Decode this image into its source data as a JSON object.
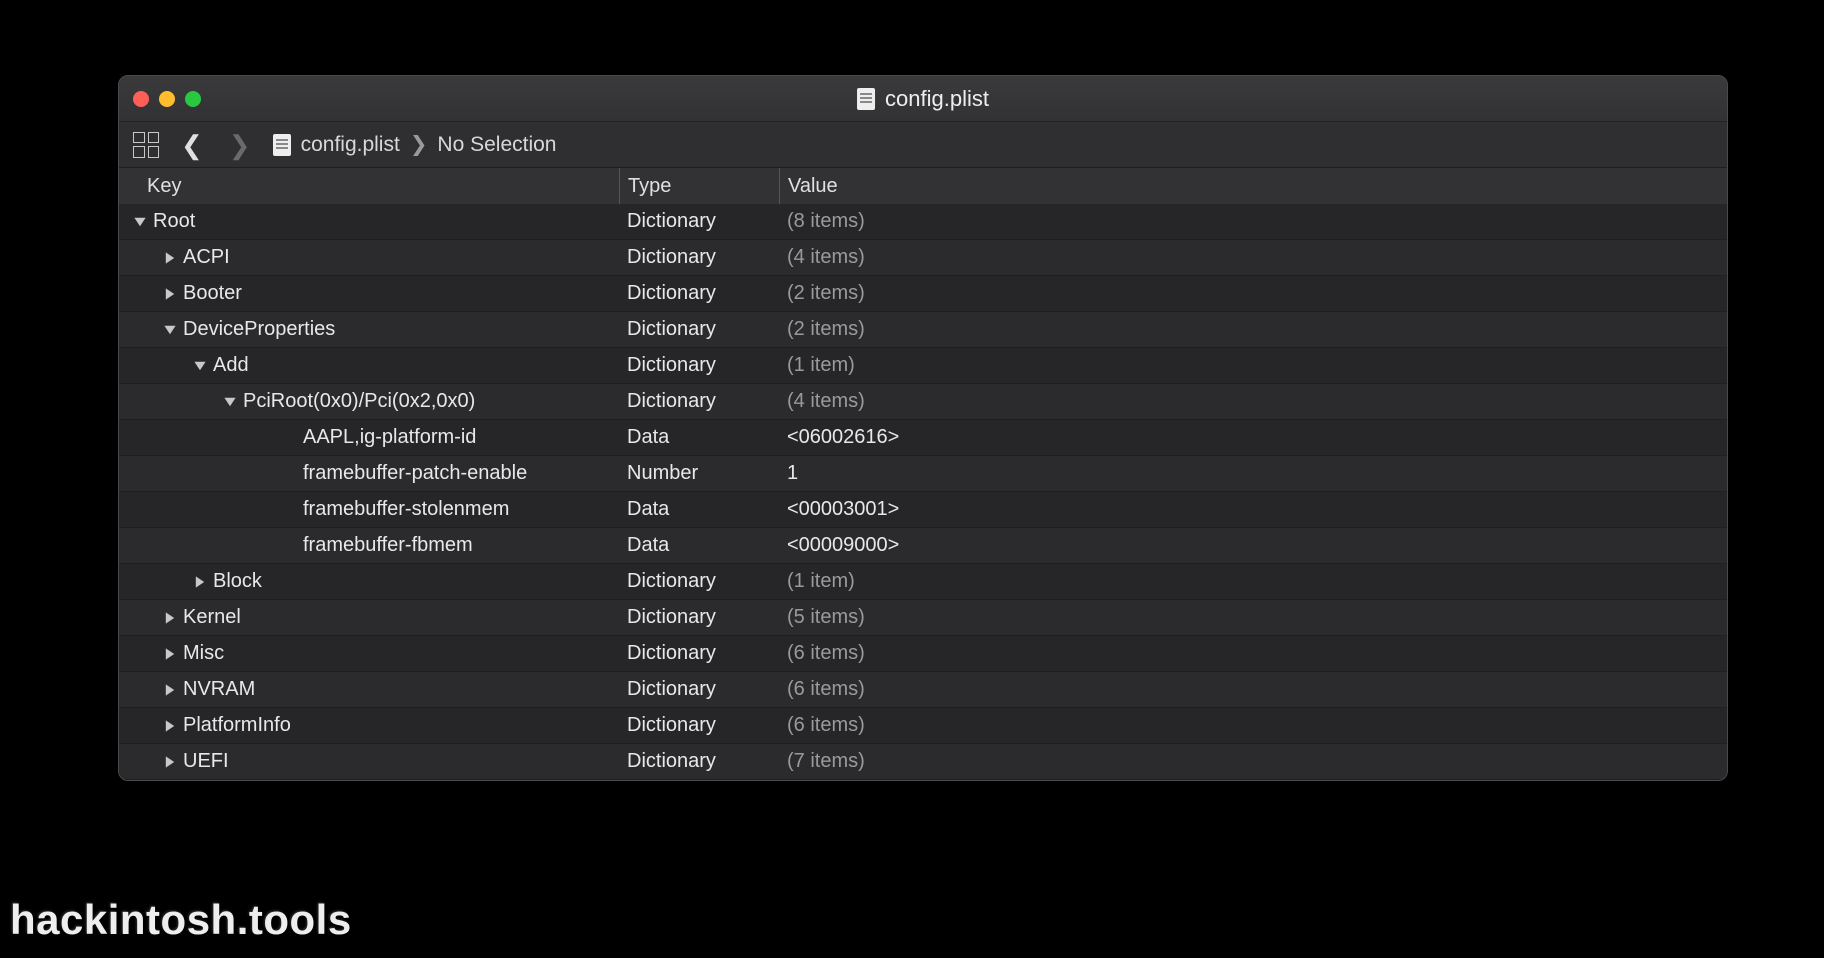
{
  "window": {
    "title": "config.plist"
  },
  "toolbar": {
    "breadcrumb_file": "config.plist",
    "breadcrumb_selection": "No Selection"
  },
  "headers": {
    "key": "Key",
    "type": "Type",
    "value": "Value"
  },
  "rows": [
    {
      "indent": 0,
      "disclosure": "down",
      "key": "Root",
      "type": "Dictionary",
      "value": "(8 items)",
      "dim": true
    },
    {
      "indent": 1,
      "disclosure": "right",
      "key": "ACPI",
      "type": "Dictionary",
      "value": "(4 items)",
      "dim": true
    },
    {
      "indent": 1,
      "disclosure": "right",
      "key": "Booter",
      "type": "Dictionary",
      "value": "(2 items)",
      "dim": true
    },
    {
      "indent": 1,
      "disclosure": "down",
      "key": "DeviceProperties",
      "type": "Dictionary",
      "value": "(2 items)",
      "dim": true
    },
    {
      "indent": 2,
      "disclosure": "down",
      "key": "Add",
      "type": "Dictionary",
      "value": "(1 item)",
      "dim": true
    },
    {
      "indent": 3,
      "disclosure": "down",
      "key": "PciRoot(0x0)/Pci(0x2,0x0)",
      "type": "Dictionary",
      "value": "(4 items)",
      "dim": true
    },
    {
      "indent": 4,
      "disclosure": "none",
      "key": "AAPL,ig-platform-id",
      "type": "Data",
      "value": "<06002616>",
      "dim": false
    },
    {
      "indent": 4,
      "disclosure": "none",
      "key": "framebuffer-patch-enable",
      "type": "Number",
      "value": "1",
      "dim": false
    },
    {
      "indent": 4,
      "disclosure": "none",
      "key": "framebuffer-stolenmem",
      "type": "Data",
      "value": "<00003001>",
      "dim": false
    },
    {
      "indent": 4,
      "disclosure": "none",
      "key": "framebuffer-fbmem",
      "type": "Data",
      "value": "<00009000>",
      "dim": false
    },
    {
      "indent": 2,
      "disclosure": "right",
      "key": "Block",
      "type": "Dictionary",
      "value": "(1 item)",
      "dim": true
    },
    {
      "indent": 1,
      "disclosure": "right",
      "key": "Kernel",
      "type": "Dictionary",
      "value": "(5 items)",
      "dim": true
    },
    {
      "indent": 1,
      "disclosure": "right",
      "key": "Misc",
      "type": "Dictionary",
      "value": "(6 items)",
      "dim": true
    },
    {
      "indent": 1,
      "disclosure": "right",
      "key": "NVRAM",
      "type": "Dictionary",
      "value": "(6 items)",
      "dim": true
    },
    {
      "indent": 1,
      "disclosure": "right",
      "key": "PlatformInfo",
      "type": "Dictionary",
      "value": "(6 items)",
      "dim": true
    },
    {
      "indent": 1,
      "disclosure": "right",
      "key": "UEFI",
      "type": "Dictionary",
      "value": "(7 items)",
      "dim": true
    }
  ],
  "watermark": "hackintosh.tools"
}
